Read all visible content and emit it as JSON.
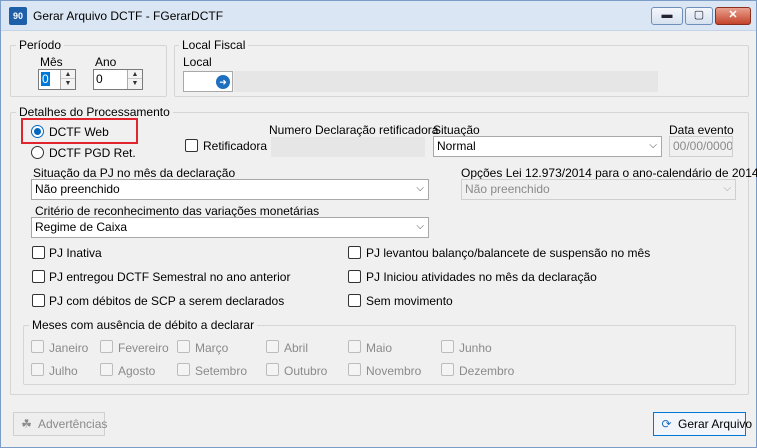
{
  "window": {
    "title": "Gerar Arquivo DCTF - FGerarDCTF",
    "icon_text": "90",
    "minimize": "▬",
    "maximize": "▢",
    "close": "✕"
  },
  "periodo": {
    "label": "Período",
    "mes_label": "Mês",
    "mes_value": "0",
    "ano_label": "Ano",
    "ano_value": "0"
  },
  "local_fiscal": {
    "label": "Local Fiscal",
    "local_label": "Local",
    "local_value": ""
  },
  "detalhes": {
    "label": "Detalhes do Processamento",
    "radio_web": "DCTF Web",
    "radio_pgd": "DCTF PGD Ret.",
    "retificadora": "Retificadora",
    "num_decl_label": "Numero Declaração retificadora",
    "situacao_label": "Situação",
    "situacao_value": "Normal",
    "data_evento_label": "Data evento",
    "data_evento_value": "00/00/0000",
    "sit_pj_label": "Situação da PJ no mês da declaração",
    "sit_pj_value": "Não preenchido",
    "opcoes_lei_label": "Opções Lei 12.973/2014 para o ano-calendário de 2014",
    "opcoes_lei_value": "Não preenchido",
    "criterio_label": "Critério de reconhecimento das variações monetárias",
    "criterio_value": "Regime de Caixa",
    "checks_left": [
      "PJ Inativa",
      "PJ entregou DCTF Semestral no ano anterior",
      "PJ com débitos de SCP a serem declarados"
    ],
    "checks_right": [
      "PJ levantou balanço/balancete de suspensão no mês",
      "PJ Iniciou atividades no mês da declaração",
      "Sem movimento"
    ]
  },
  "meses": {
    "label": "Meses com ausência de débito a declarar",
    "items": [
      "Janeiro",
      "Fevereiro",
      "Março",
      "Abril",
      "Maio",
      "Junho",
      "Julho",
      "Agosto",
      "Setembro",
      "Outubro",
      "Novembro",
      "Dezembro"
    ]
  },
  "footer": {
    "advertencias": "Advertências",
    "gerar": "Gerar Arquivo"
  },
  "colors": {
    "accent": "#0067c0",
    "highlight_border": "#e0252e"
  }
}
